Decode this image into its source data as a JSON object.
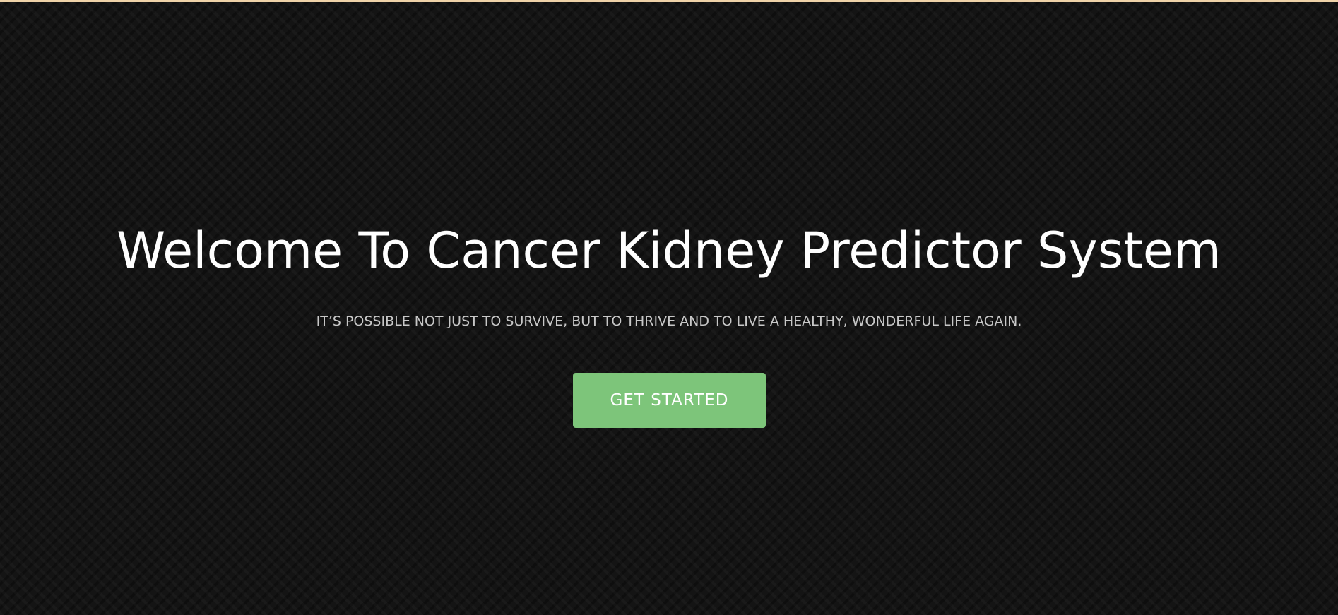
{
  "hero": {
    "title": "Welcome To Cancer Kidney Predictor System",
    "subtitle": "IT’S POSSIBLE NOT JUST TO SURVIVE, BUT TO THRIVE AND TO LIVE A HEALTHY, WONDERFUL LIFE AGAIN.",
    "cta_label": "GET STARTED"
  },
  "colors": {
    "background": "#141414",
    "top_border": "#efd2a8",
    "cta": "#7dc57a",
    "title": "#ffffff",
    "subtitle": "#c8c8c8"
  }
}
